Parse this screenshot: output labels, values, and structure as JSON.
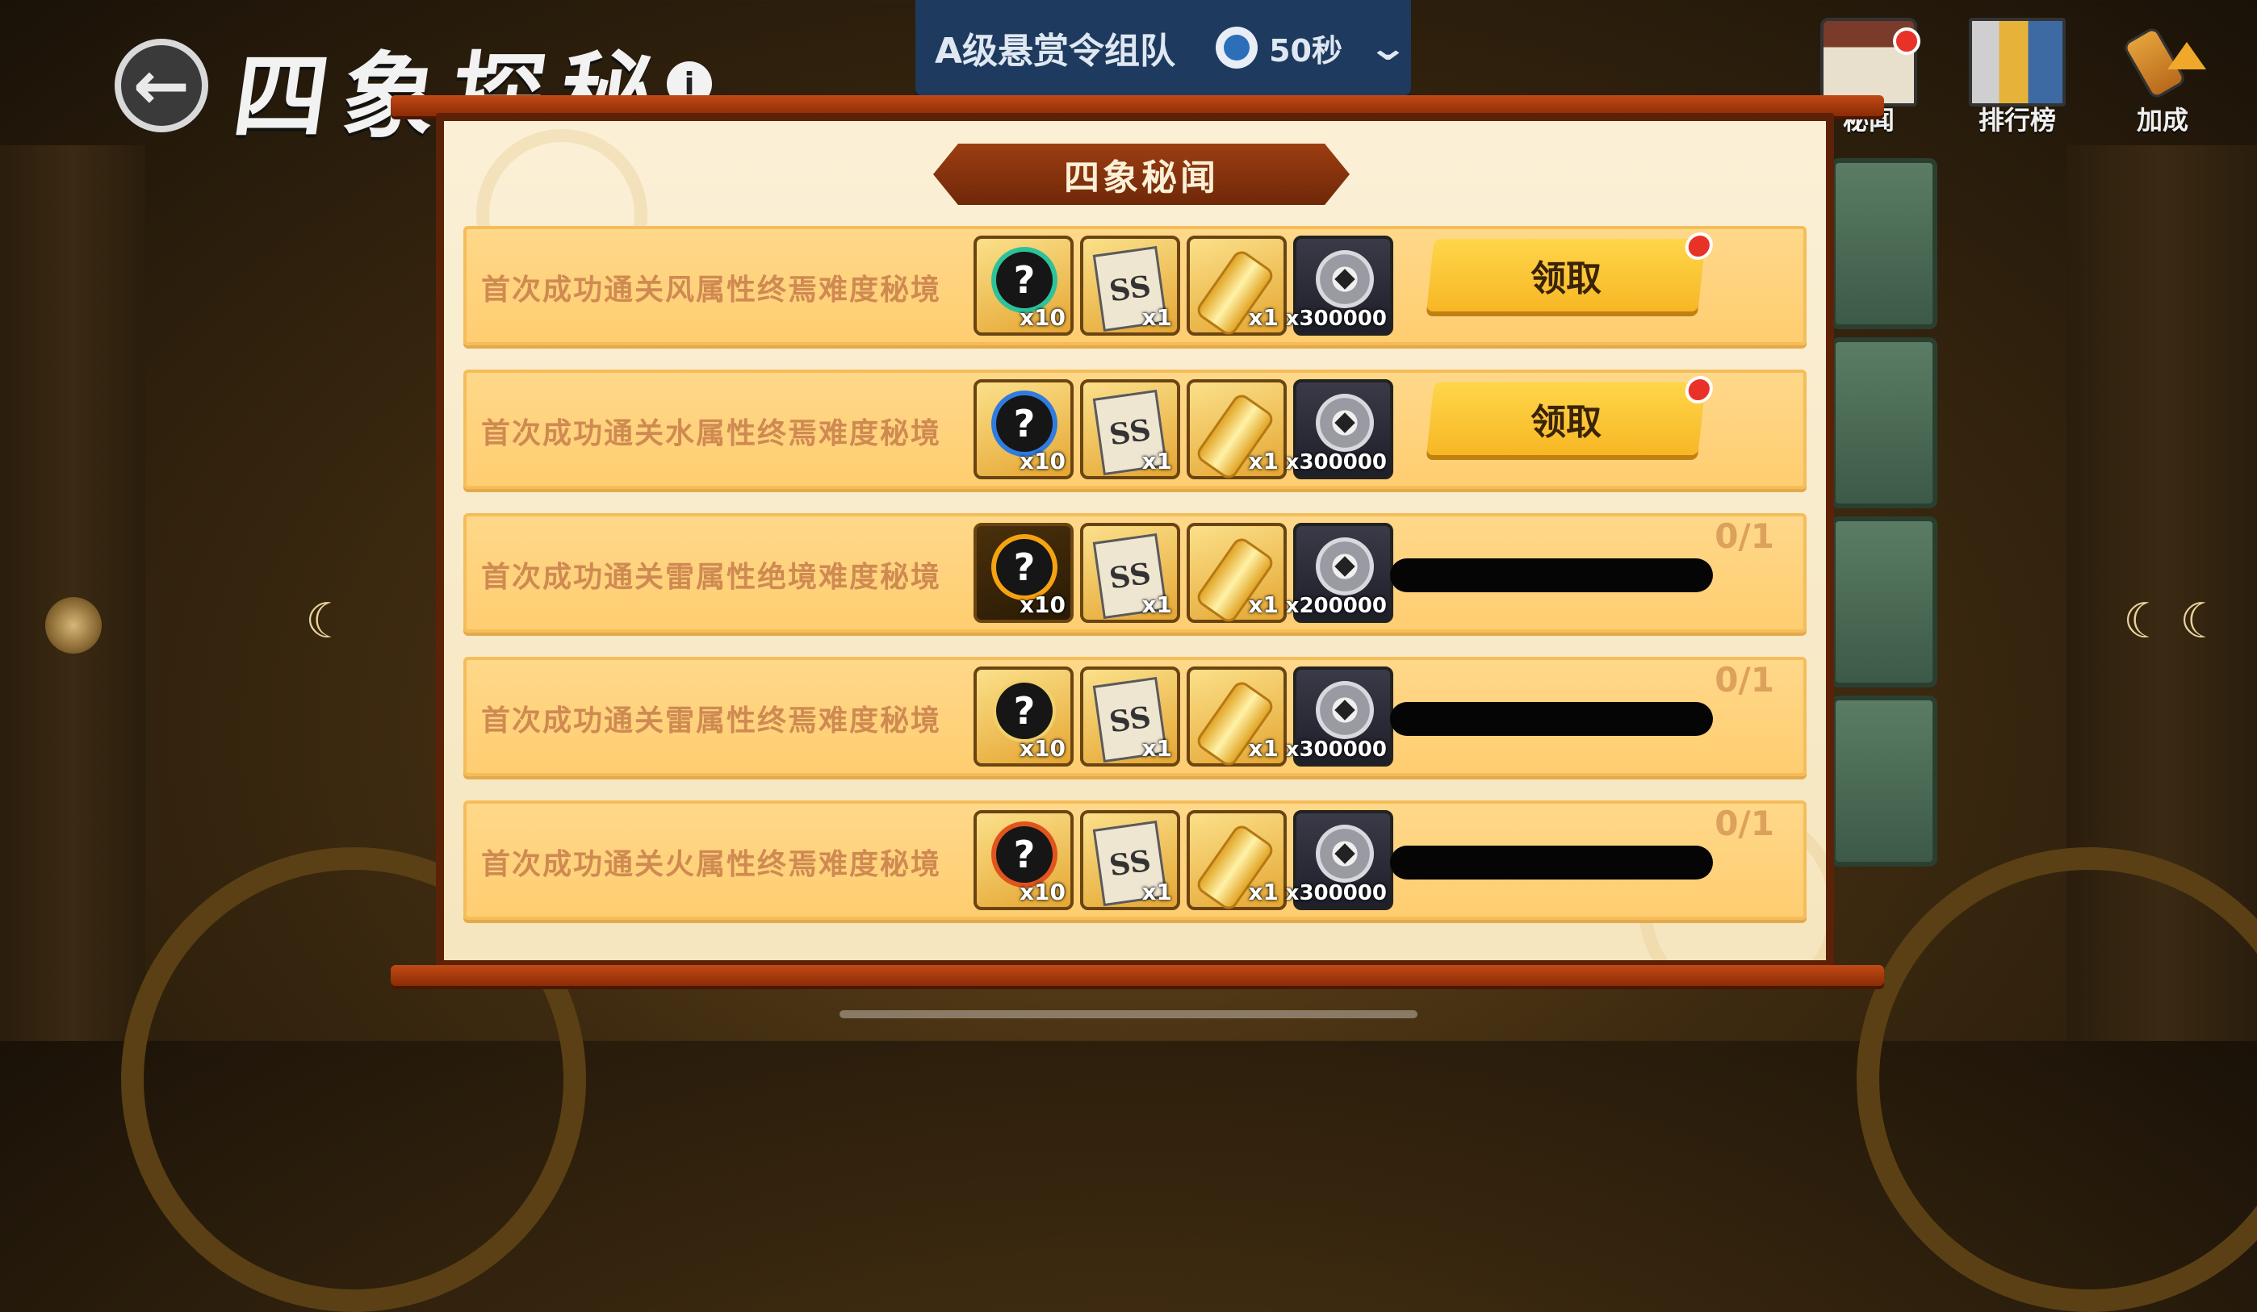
{
  "header": {
    "page_title": "四象探秘",
    "info_icon": "i"
  },
  "team_banner": {
    "title": "A级悬赏令组队",
    "timer": "50秒"
  },
  "top_menu": [
    {
      "label": "秘闻",
      "icon": "secret-lore-icon",
      "badge": true
    },
    {
      "label": "排行榜",
      "icon": "leaderboard-icon",
      "badge": false
    },
    {
      "label": "加成",
      "icon": "bonus-icon",
      "badge": false
    }
  ],
  "panel": {
    "title": "四象秘闻",
    "claim_label": "领取",
    "rows": [
      {
        "description": "首次成功通关风属性终焉难度秘境",
        "element": "wind",
        "status": "claimable",
        "rewards": {
          "orb_qty": "x10",
          "ss_scroll_qty": "x1",
          "gold_scroll_qty": "x1",
          "coin_qty": "x300000"
        }
      },
      {
        "description": "首次成功通关水属性终焉难度秘境",
        "element": "water",
        "status": "claimable",
        "rewards": {
          "orb_qty": "x10",
          "ss_scroll_qty": "x1",
          "gold_scroll_qty": "x1",
          "coin_qty": "x300000"
        }
      },
      {
        "description": "首次成功通关雷属性绝境难度秘境",
        "element": "thunder",
        "status": "in_progress",
        "progress_text": "0/1",
        "progress_fraction": 0,
        "rewards": {
          "orb_qty": "x10",
          "ss_scroll_qty": "x1",
          "gold_scroll_qty": "x1",
          "coin_qty": "x200000"
        }
      },
      {
        "description": "首次成功通关雷属性终焉难度秘境",
        "element": "thunder",
        "status": "in_progress",
        "progress_text": "0/1",
        "progress_fraction": 0,
        "rewards": {
          "orb_qty": "x10",
          "ss_scroll_qty": "x1",
          "gold_scroll_qty": "x1",
          "coin_qty": "x300000"
        }
      },
      {
        "description": "首次成功通关火属性终焉难度秘境",
        "element": "fire",
        "status": "in_progress",
        "progress_text": "0/1",
        "progress_fraction": 0,
        "rewards": {
          "orb_qty": "x10",
          "ss_scroll_qty": "x1",
          "gold_scroll_qty": "x1",
          "coin_qty": "x300000"
        }
      }
    ]
  },
  "colors": {
    "claim_button": "#f7b724",
    "row_background": "#ffd88a",
    "header_ribbon": "#9c3e12",
    "badge_red": "#e83228",
    "team_banner": "#1e3a5e"
  }
}
